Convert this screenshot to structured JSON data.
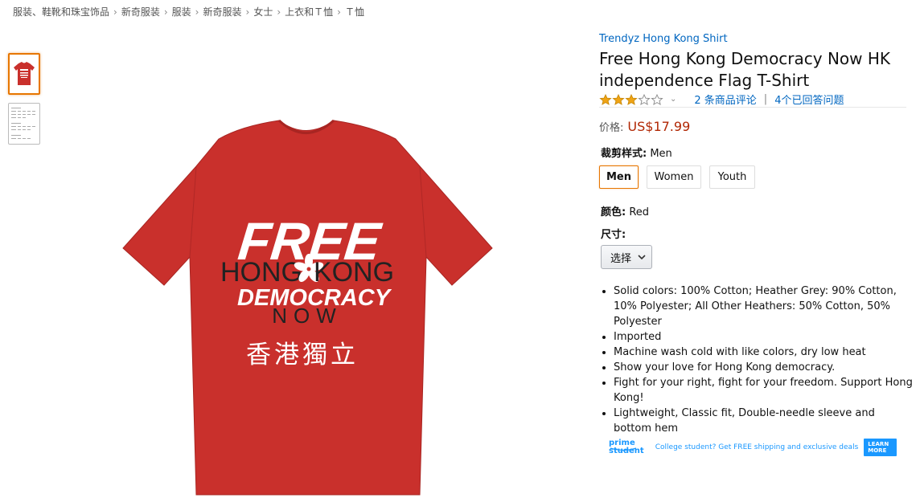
{
  "breadcrumb": [
    "服装、鞋靴和珠宝饰品",
    "新奇服装",
    "服装",
    "新奇服装",
    "女士",
    "上衣和Ｔ恤",
    "Ｔ恤"
  ],
  "product": {
    "brand": "Trendyz Hong Kong Shirt",
    "title": "Free Hong Kong Democracy Now HK independence Flag T-Shirt",
    "rating_stars": 3,
    "reviews_link": "2 条商品评论",
    "answered_link": "4个已回答问题",
    "price_label": "价格:",
    "price": "US$17.99",
    "shirt_color": "#c9302c"
  },
  "shirt_print": {
    "line1": "FREE",
    "hong": "HONG",
    "kong": "KONG",
    "democracy": "DEMOCRACY",
    "now": "NOW",
    "chinese": "香港獨立"
  },
  "options": {
    "fit_label": "裁剪样式:",
    "fit_value": "Men",
    "fit_buttons": [
      "Men",
      "Women",
      "Youth"
    ],
    "color_label": "颜色:",
    "color_value": "Red",
    "size_label": "尺寸:",
    "size_dropdown": "选择"
  },
  "bullets": [
    "Solid colors: 100% Cotton; Heather Grey: 90% Cotton, 10% Polyester; All Other Heathers: 50% Cotton, 50% Polyester",
    "Imported",
    "Machine wash cold with like colors, dry low heat",
    "Show your love for Hong Kong democracy.",
    "Fight for your right, fight for your freedom. Support Hong Kong!",
    "Lightweight, Classic fit, Double-needle sleeve and bottom hem"
  ],
  "prime_student": {
    "logo": "prime student",
    "text": "College student? Get FREE shipping and exclusive deals",
    "button": "LEARN MORE"
  },
  "colors": {
    "link": "#0066c0",
    "price": "#b12704",
    "selected_border": "#e77600",
    "star": "#f0a414",
    "prime": "#1a98ff"
  }
}
